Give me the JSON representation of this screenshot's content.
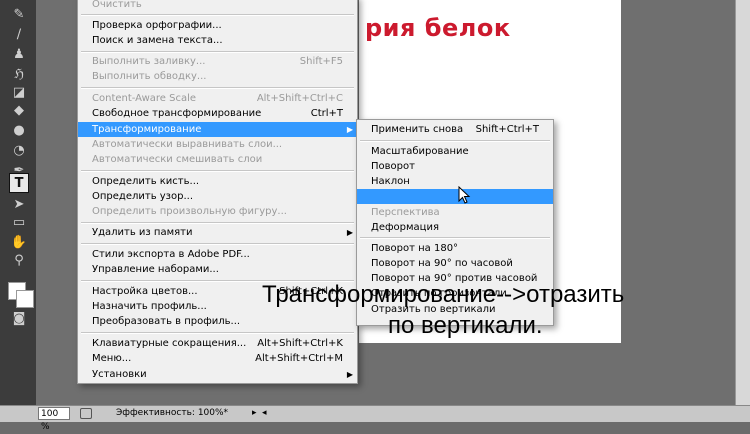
{
  "main_menu": {
    "items": [
      {
        "label": "Очистить",
        "shortcut": "",
        "disabled": true
      },
      {
        "label": "Проверка орфографии...",
        "shortcut": "",
        "disabled": false
      },
      {
        "label": "Поиск и замена текста...",
        "shortcut": "",
        "disabled": false
      },
      {
        "label": "Выполнить заливку...",
        "shortcut": "Shift+F5",
        "disabled": true
      },
      {
        "label": "Выполнить обводку...",
        "shortcut": "",
        "disabled": true
      },
      {
        "label": "Content-Aware Scale",
        "shortcut": "Alt+Shift+Ctrl+C",
        "disabled": true
      },
      {
        "label": "Свободное трансформирование",
        "shortcut": "Ctrl+T",
        "disabled": false
      },
      {
        "label": "Трансформирование",
        "shortcut": "",
        "disabled": false,
        "submenu": true,
        "highlighted": true
      },
      {
        "label": "Автоматически выравнивать слои...",
        "shortcut": "",
        "disabled": true
      },
      {
        "label": "Автоматически смешивать слои",
        "shortcut": "",
        "disabled": true
      },
      {
        "label": "Определить кисть...",
        "shortcut": "",
        "disabled": false
      },
      {
        "label": "Определить узор...",
        "shortcut": "",
        "disabled": false
      },
      {
        "label": "Определить произвольную фигуру...",
        "shortcut": "",
        "disabled": true
      },
      {
        "label": "Удалить из памяти",
        "shortcut": "",
        "disabled": false,
        "submenu": true
      },
      {
        "label": "Стили экспорта в Adobe PDF...",
        "shortcut": "",
        "disabled": false
      },
      {
        "label": "Управление наборами...",
        "shortcut": "",
        "disabled": false
      },
      {
        "label": "Настройка цветов...",
        "shortcut": "Shift+Ctrl+K",
        "disabled": false
      },
      {
        "label": "Назначить профиль...",
        "shortcut": "",
        "disabled": false
      },
      {
        "label": "Преобразовать в профиль...",
        "shortcut": "",
        "disabled": false
      },
      {
        "label": "Клавиатурные сокращения...",
        "shortcut": "Alt+Shift+Ctrl+K",
        "disabled": false
      },
      {
        "label": "Меню...",
        "shortcut": "Alt+Shift+Ctrl+M",
        "disabled": false
      },
      {
        "label": "Установки",
        "shortcut": "",
        "disabled": false,
        "submenu": true
      }
    ]
  },
  "submenu": {
    "items": [
      {
        "label": "Применить снова",
        "shortcut": "Shift+Ctrl+T",
        "disabled": false
      },
      {
        "label": "Масштабирование",
        "shortcut": "",
        "disabled": false
      },
      {
        "label": "Поворот",
        "shortcut": "",
        "disabled": false
      },
      {
        "label": "Наклон",
        "shortcut": "",
        "disabled": false
      },
      {
        "label": "",
        "shortcut": "",
        "disabled": false,
        "highlighted": true
      },
      {
        "label": "Перспектива",
        "shortcut": "",
        "disabled": true
      },
      {
        "label": "Деформация",
        "shortcut": "",
        "disabled": false
      },
      {
        "label": "Поворот на 180°",
        "shortcut": "",
        "disabled": false
      },
      {
        "label": "Поворот на 90° по часовой",
        "shortcut": "",
        "disabled": false
      },
      {
        "label": "Поворот на 90° против часовой",
        "shortcut": "",
        "disabled": false
      },
      {
        "label": "Отразить по горизонтали",
        "shortcut": "",
        "disabled": false
      },
      {
        "label": "Отразить по вертикали",
        "shortcut": "",
        "disabled": false
      }
    ]
  },
  "canvas": {
    "title_text": "рия белок"
  },
  "caption": {
    "line1": "Трансформирование-->отразить",
    "line2": "по вертикали."
  },
  "status": {
    "zoom": "100 %",
    "efficiency": "Эффективность: 100%*"
  },
  "colors": {
    "accent": "#3399ff",
    "canvas_title": "#cc1a2e"
  },
  "icons": [
    "brush-icon",
    "pencil-icon",
    "stamp-icon",
    "history-brush-icon",
    "eraser-icon",
    "bucket-icon",
    "dodge-icon",
    "pen-icon",
    "type-icon",
    "path-select-icon",
    "shape-icon",
    "hand-icon",
    "zoom-icon",
    "mouse-cursor-icon"
  ]
}
